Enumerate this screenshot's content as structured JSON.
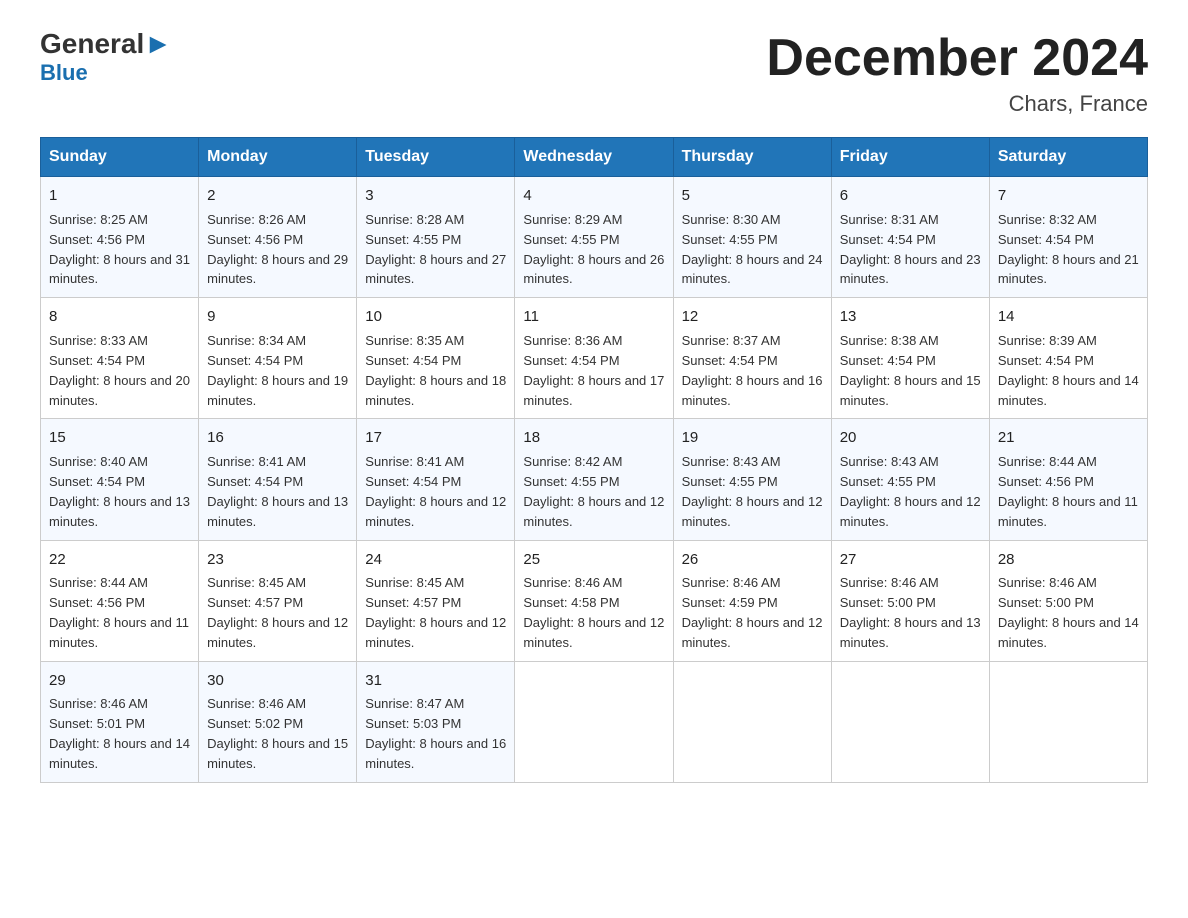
{
  "logo": {
    "general": "General",
    "blue": "Blue",
    "arrow": "▶"
  },
  "title": "December 2024",
  "location": "Chars, France",
  "weekdays": [
    "Sunday",
    "Monday",
    "Tuesday",
    "Wednesday",
    "Thursday",
    "Friday",
    "Saturday"
  ],
  "weeks": [
    [
      {
        "day": "1",
        "sunrise": "8:25 AM",
        "sunset": "4:56 PM",
        "daylight": "8 hours and 31 minutes."
      },
      {
        "day": "2",
        "sunrise": "8:26 AM",
        "sunset": "4:56 PM",
        "daylight": "8 hours and 29 minutes."
      },
      {
        "day": "3",
        "sunrise": "8:28 AM",
        "sunset": "4:55 PM",
        "daylight": "8 hours and 27 minutes."
      },
      {
        "day": "4",
        "sunrise": "8:29 AM",
        "sunset": "4:55 PM",
        "daylight": "8 hours and 26 minutes."
      },
      {
        "day": "5",
        "sunrise": "8:30 AM",
        "sunset": "4:55 PM",
        "daylight": "8 hours and 24 minutes."
      },
      {
        "day": "6",
        "sunrise": "8:31 AM",
        "sunset": "4:54 PM",
        "daylight": "8 hours and 23 minutes."
      },
      {
        "day": "7",
        "sunrise": "8:32 AM",
        "sunset": "4:54 PM",
        "daylight": "8 hours and 21 minutes."
      }
    ],
    [
      {
        "day": "8",
        "sunrise": "8:33 AM",
        "sunset": "4:54 PM",
        "daylight": "8 hours and 20 minutes."
      },
      {
        "day": "9",
        "sunrise": "8:34 AM",
        "sunset": "4:54 PM",
        "daylight": "8 hours and 19 minutes."
      },
      {
        "day": "10",
        "sunrise": "8:35 AM",
        "sunset": "4:54 PM",
        "daylight": "8 hours and 18 minutes."
      },
      {
        "day": "11",
        "sunrise": "8:36 AM",
        "sunset": "4:54 PM",
        "daylight": "8 hours and 17 minutes."
      },
      {
        "day": "12",
        "sunrise": "8:37 AM",
        "sunset": "4:54 PM",
        "daylight": "8 hours and 16 minutes."
      },
      {
        "day": "13",
        "sunrise": "8:38 AM",
        "sunset": "4:54 PM",
        "daylight": "8 hours and 15 minutes."
      },
      {
        "day": "14",
        "sunrise": "8:39 AM",
        "sunset": "4:54 PM",
        "daylight": "8 hours and 14 minutes."
      }
    ],
    [
      {
        "day": "15",
        "sunrise": "8:40 AM",
        "sunset": "4:54 PM",
        "daylight": "8 hours and 13 minutes."
      },
      {
        "day": "16",
        "sunrise": "8:41 AM",
        "sunset": "4:54 PM",
        "daylight": "8 hours and 13 minutes."
      },
      {
        "day": "17",
        "sunrise": "8:41 AM",
        "sunset": "4:54 PM",
        "daylight": "8 hours and 12 minutes."
      },
      {
        "day": "18",
        "sunrise": "8:42 AM",
        "sunset": "4:55 PM",
        "daylight": "8 hours and 12 minutes."
      },
      {
        "day": "19",
        "sunrise": "8:43 AM",
        "sunset": "4:55 PM",
        "daylight": "8 hours and 12 minutes."
      },
      {
        "day": "20",
        "sunrise": "8:43 AM",
        "sunset": "4:55 PM",
        "daylight": "8 hours and 12 minutes."
      },
      {
        "day": "21",
        "sunrise": "8:44 AM",
        "sunset": "4:56 PM",
        "daylight": "8 hours and 11 minutes."
      }
    ],
    [
      {
        "day": "22",
        "sunrise": "8:44 AM",
        "sunset": "4:56 PM",
        "daylight": "8 hours and 11 minutes."
      },
      {
        "day": "23",
        "sunrise": "8:45 AM",
        "sunset": "4:57 PM",
        "daylight": "8 hours and 12 minutes."
      },
      {
        "day": "24",
        "sunrise": "8:45 AM",
        "sunset": "4:57 PM",
        "daylight": "8 hours and 12 minutes."
      },
      {
        "day": "25",
        "sunrise": "8:46 AM",
        "sunset": "4:58 PM",
        "daylight": "8 hours and 12 minutes."
      },
      {
        "day": "26",
        "sunrise": "8:46 AM",
        "sunset": "4:59 PM",
        "daylight": "8 hours and 12 minutes."
      },
      {
        "day": "27",
        "sunrise": "8:46 AM",
        "sunset": "5:00 PM",
        "daylight": "8 hours and 13 minutes."
      },
      {
        "day": "28",
        "sunrise": "8:46 AM",
        "sunset": "5:00 PM",
        "daylight": "8 hours and 14 minutes."
      }
    ],
    [
      {
        "day": "29",
        "sunrise": "8:46 AM",
        "sunset": "5:01 PM",
        "daylight": "8 hours and 14 minutes."
      },
      {
        "day": "30",
        "sunrise": "8:46 AM",
        "sunset": "5:02 PM",
        "daylight": "8 hours and 15 minutes."
      },
      {
        "day": "31",
        "sunrise": "8:47 AM",
        "sunset": "5:03 PM",
        "daylight": "8 hours and 16 minutes."
      },
      null,
      null,
      null,
      null
    ]
  ],
  "labels": {
    "sunrise": "Sunrise:",
    "sunset": "Sunset:",
    "daylight": "Daylight:"
  }
}
